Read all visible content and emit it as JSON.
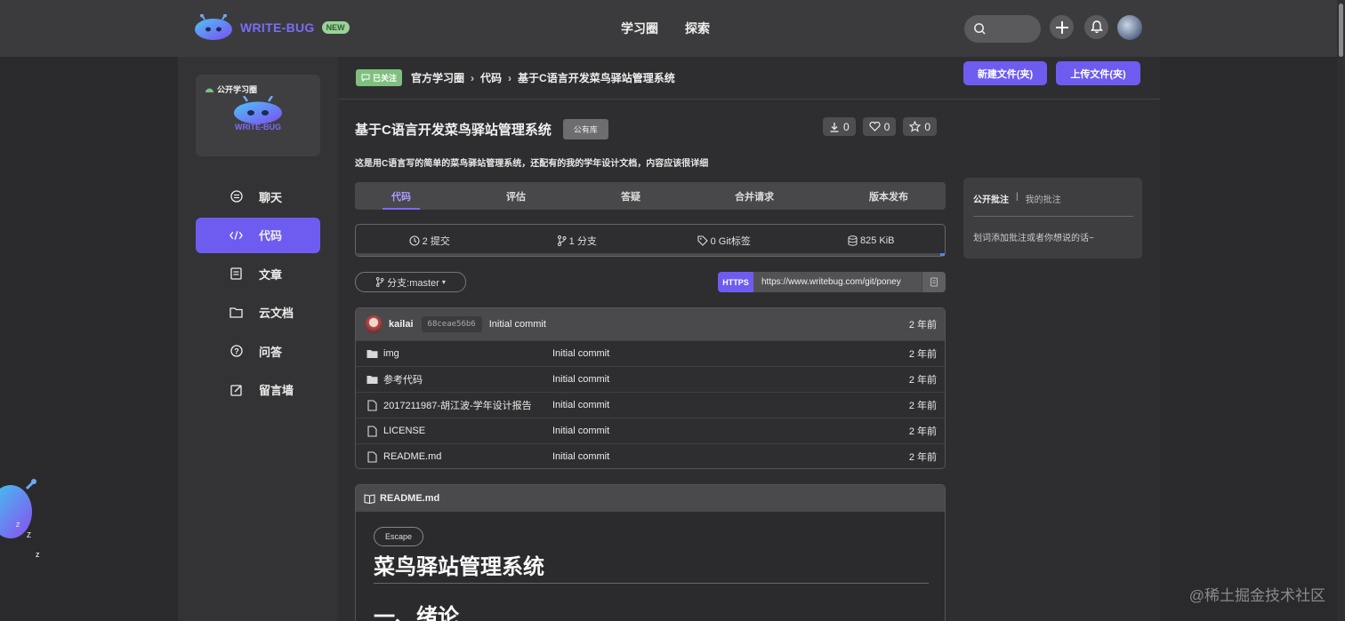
{
  "header": {
    "logo_text": "WRITE-BUG",
    "new_badge": "NEW",
    "nav": [
      "学习圈",
      "探索"
    ]
  },
  "sidebar": {
    "group_tag": "公开学习圈",
    "group_logo_text": "WRITE-BUG",
    "items": [
      {
        "label": "聊天",
        "icon": "chat-icon"
      },
      {
        "label": "代码",
        "icon": "code-icon"
      },
      {
        "label": "文章",
        "icon": "article-icon"
      },
      {
        "label": "云文档",
        "icon": "folder-icon"
      },
      {
        "label": "问答",
        "icon": "question-icon"
      },
      {
        "label": "留言墙",
        "icon": "edit-icon"
      }
    ],
    "active_index": 1
  },
  "breadcrumb": {
    "follow_label": "已关注",
    "items": [
      "官方学习圈",
      "代码",
      "基于C语言开发菜鸟驿站管理系统"
    ]
  },
  "repo": {
    "title": "基于C语言开发菜鸟驿站管理系统",
    "visibility": "公有库",
    "downloads": "0",
    "likes": "0",
    "stars": "0",
    "new_file_label": "新建文件(夹)",
    "upload_label": "上传文件(夹)",
    "description": "这是用C语言写的简单的菜鸟驿站管理系统，还配有的我的学年设计文档，内容应该很详细"
  },
  "tabs": [
    "代码",
    "评估",
    "答疑",
    "合并请求",
    "版本发布"
  ],
  "repo_stats": {
    "commits": "2 提交",
    "branches": "1 分支",
    "tags": "0 Git标签",
    "size": "825 KiB"
  },
  "branch_label": "分支:master",
  "clone": {
    "protocol": "HTTPS",
    "url": "https://www.writebug.com/git/poney"
  },
  "last_commit": {
    "user": "kailai",
    "sha": "68ceae56b6",
    "message": "Initial commit",
    "time": "2 年前"
  },
  "files": [
    {
      "name": "img",
      "type": "folder",
      "commit": "Initial commit",
      "time": "2 年前"
    },
    {
      "name": "参考代码",
      "type": "folder",
      "commit": "Initial commit",
      "time": "2 年前"
    },
    {
      "name": "2017211987-胡江波-学年设计报告",
      "type": "file",
      "commit": "Initial commit",
      "time": "2 年前"
    },
    {
      "name": "LICENSE",
      "type": "file",
      "commit": "Initial commit",
      "time": "2 年前"
    },
    {
      "name": "README.md",
      "type": "file",
      "commit": "Initial commit",
      "time": "2 年前"
    }
  ],
  "readme": {
    "filename": "README.md",
    "escape_label": "Escape",
    "h1": "菜鸟驿站管理系统",
    "h2": "一、绪论"
  },
  "annotations": {
    "tab_public": "公开批注",
    "separator": "|",
    "tab_mine": "我的批注",
    "hint": "划词添加批注或者你想说的话~"
  },
  "watermark": "@稀土掘金技术社区",
  "colors": {
    "accent": "#6e5cf0",
    "follow_green": "#7fc07f",
    "header_bg": "#3b3b3d"
  }
}
